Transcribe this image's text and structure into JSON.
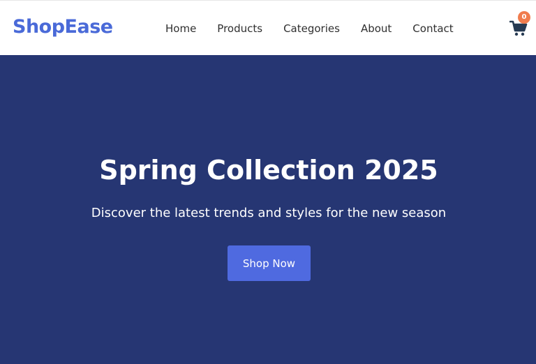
{
  "header": {
    "logo": "ShopEase",
    "nav_items": [
      "Home",
      "Products",
      "Categories",
      "About",
      "Contact"
    ],
    "cart": {
      "icon": "cart-icon",
      "count": "0"
    }
  },
  "hero": {
    "title": "Spring Collection 2025",
    "subtitle": "Discover the latest trends and styles for the new season",
    "button_label": "Shop Now"
  },
  "colors": {
    "brand": "#4a6ad8",
    "hero_background": "#263673",
    "button": "#4f6ae0",
    "badge": "#f07c4d"
  }
}
